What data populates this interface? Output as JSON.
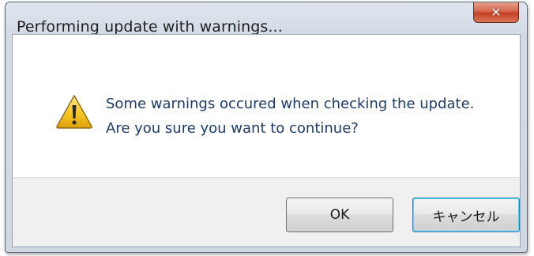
{
  "window": {
    "title": "Performing update with warnings...",
    "close_icon": "close-icon",
    "close_glyph": "✕"
  },
  "dialog": {
    "icon": "warning-icon",
    "message_line1": "Some warnings occured when checking the update.",
    "message_line2": "Are you sure you want to continue?"
  },
  "buttons": {
    "ok_label": "OK",
    "cancel_label": "キャンセル"
  },
  "colors": {
    "message_text": "#1e3a66",
    "close_button": "#c23f22",
    "warning_fill": "#f7c623",
    "default_button_border": "#3c7fb1"
  }
}
